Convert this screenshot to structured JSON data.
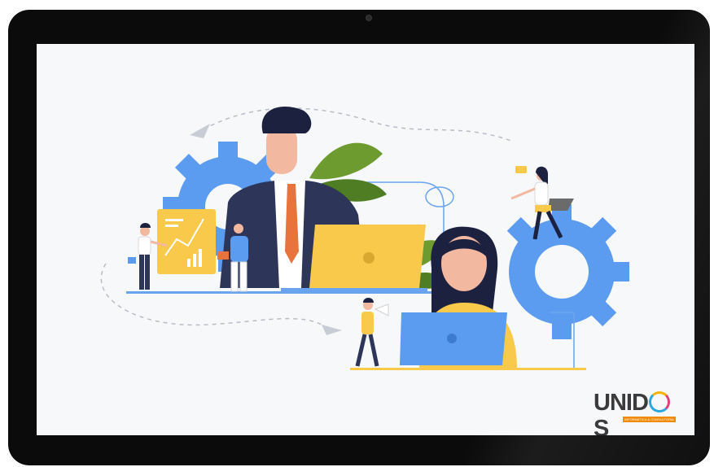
{
  "logo": {
    "brand": "UNIDOS",
    "brand_pre": "UNID",
    "brand_post": "S",
    "tagline": "INFORMÁTICA & CONSULTORIA"
  },
  "colors": {
    "bezel": "#0b0b0b",
    "screen_bg": "#f7f8fa",
    "gear_blue": "#5b9cf0",
    "accent_yellow": "#f8c94a",
    "navy": "#2d3558",
    "tie_orange": "#e8733d",
    "leaf_green": "#5c8f2e"
  },
  "illustration": {
    "figures": [
      "businessman-with-laptop",
      "woman-with-laptop",
      "presenter-at-chart",
      "man-with-clipboard",
      "woman-sitting-on-gear",
      "man-with-megaphone"
    ],
    "icons": [
      "gear-icon",
      "chart-board-icon",
      "leaf-icon",
      "paper-plane-icon"
    ]
  }
}
